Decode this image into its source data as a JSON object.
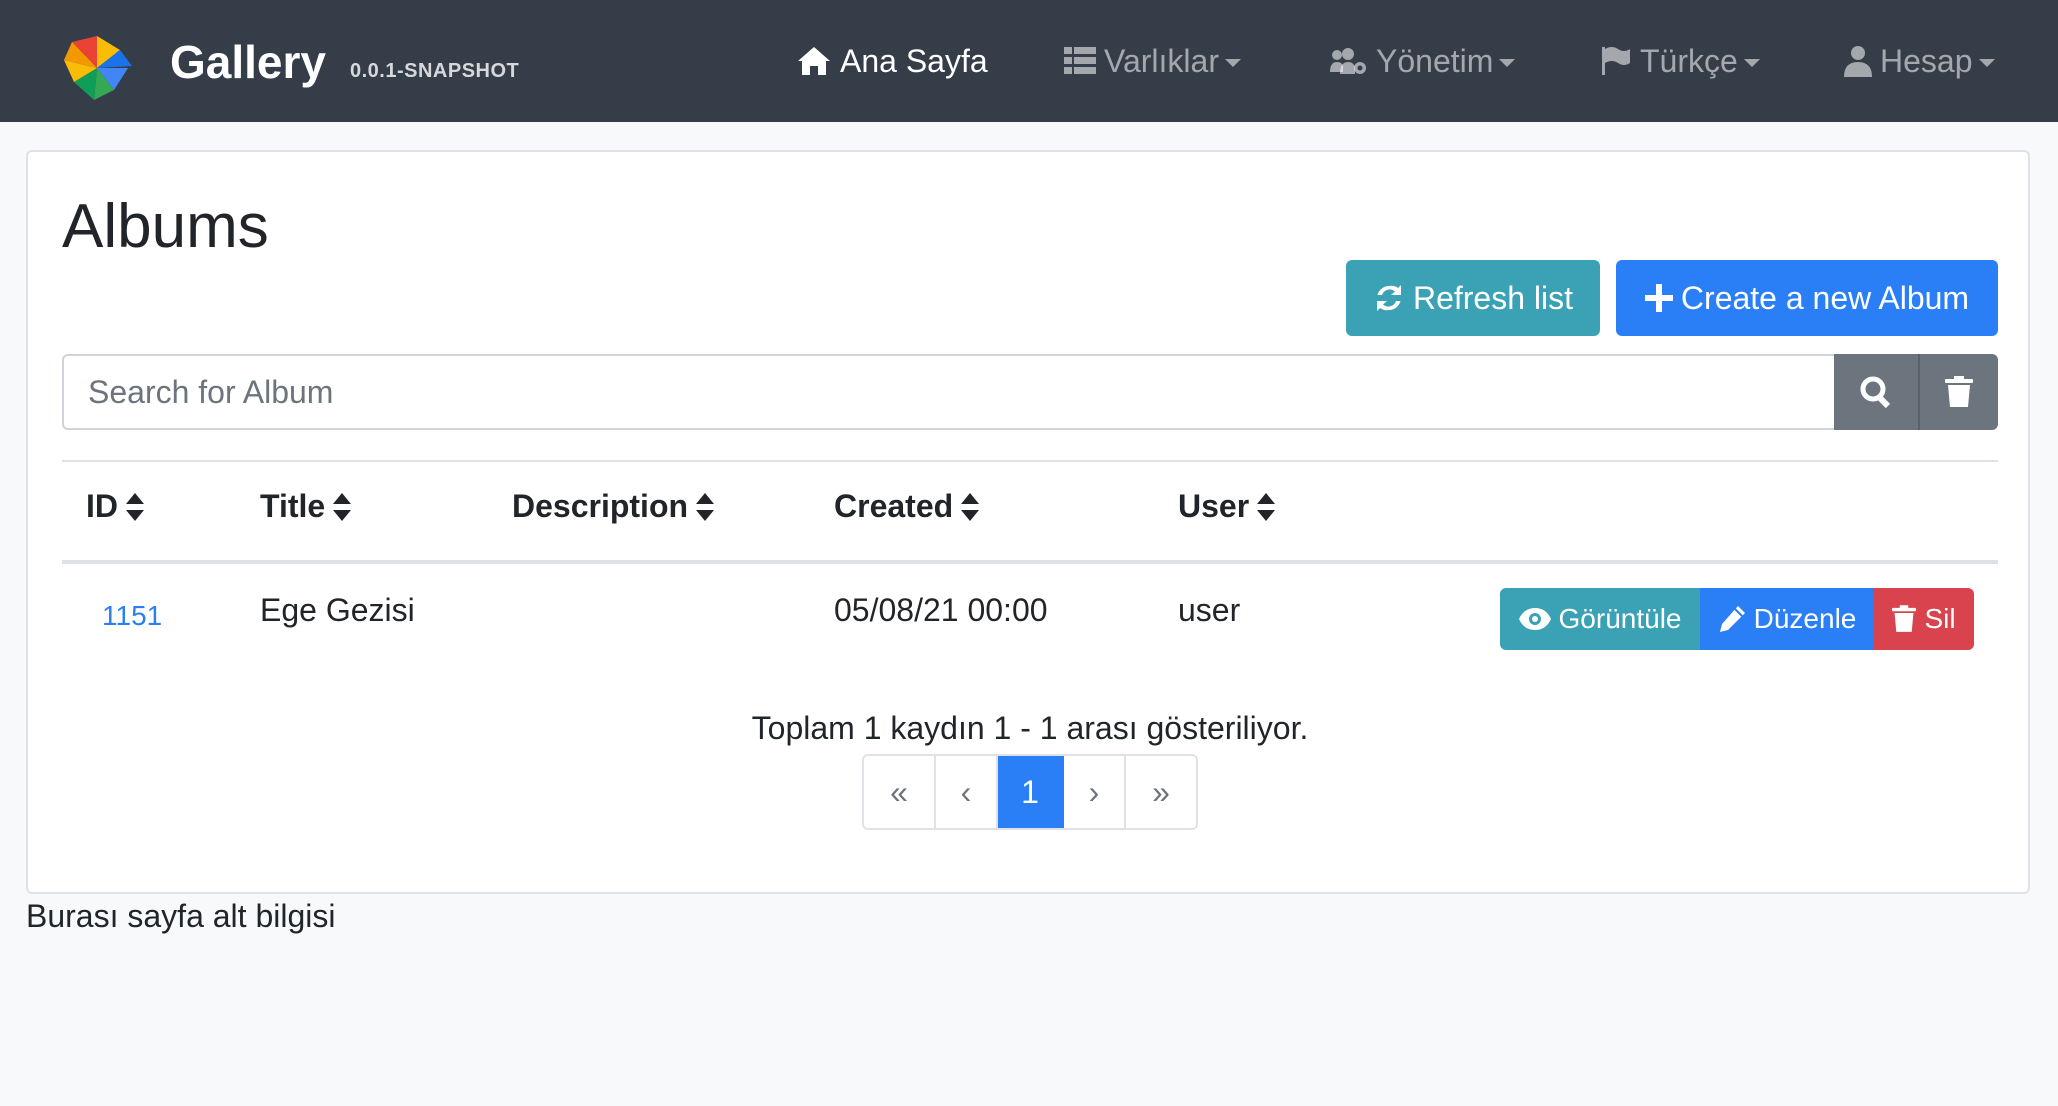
{
  "navbar": {
    "brand_title": "Gallery",
    "brand_version": "0.0.1-SNAPSHOT",
    "items": [
      {
        "label": "Ana Sayfa",
        "icon": "home-icon"
      },
      {
        "label": "Varlıklar",
        "icon": "list-icon"
      },
      {
        "label": "Yönetim",
        "icon": "users-cog-icon"
      },
      {
        "label": "Türkçe",
        "icon": "flag-icon"
      },
      {
        "label": "Hesap",
        "icon": "user-icon"
      }
    ]
  },
  "page": {
    "title": "Albums",
    "refresh_label": "Refresh list",
    "create_label": "Create a new Album"
  },
  "search": {
    "placeholder": "Search for Album",
    "value": ""
  },
  "table": {
    "columns": [
      "ID",
      "Title",
      "Description",
      "Created",
      "User"
    ],
    "rows": [
      {
        "id": "1151",
        "title": "Ege Gezisi",
        "description": "",
        "created": "05/08/21 00:00",
        "user": "user"
      }
    ],
    "actions": {
      "view": "Görüntüle",
      "edit": "Düzenle",
      "delete": "Sil"
    }
  },
  "pagination": {
    "summary": "Toplam 1 kaydın 1 - 1 arası gösteriliyor.",
    "first": "«",
    "prev": "‹",
    "current": "1",
    "next": "›",
    "last": "»"
  },
  "footer": {
    "text": "Burası sayfa alt bilgisi"
  },
  "colors": {
    "navbar_bg": "#353d48",
    "info": "#3ba2b6",
    "primary": "#2a7ff7",
    "danger": "#d9434e",
    "secondary": "#6c757d"
  }
}
